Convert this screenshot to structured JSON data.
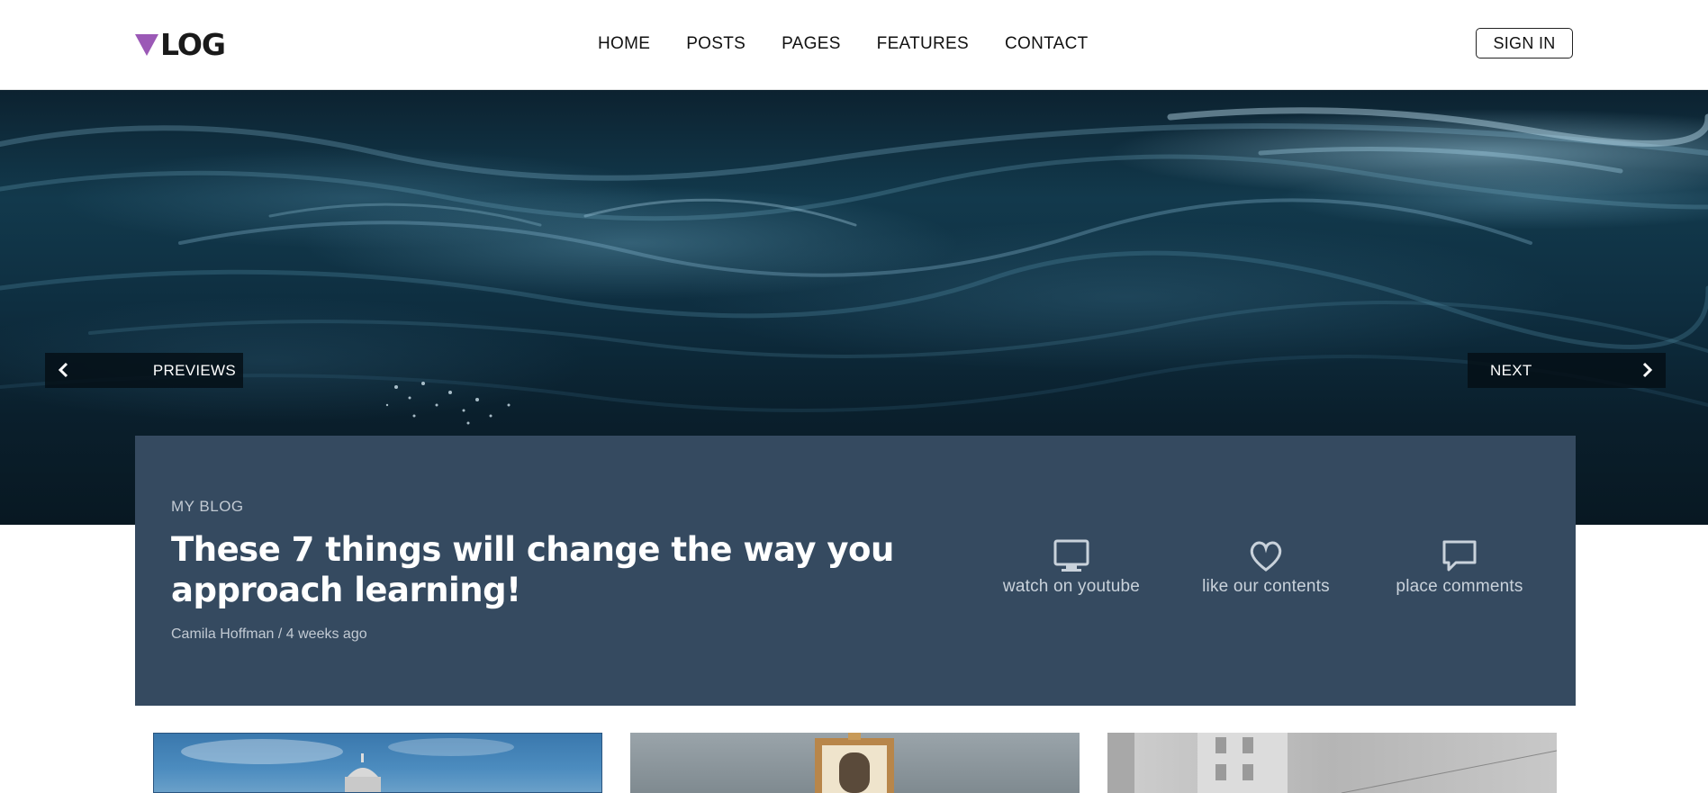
{
  "brand": {
    "logo_text": "LOG",
    "accent_color": "#9b59b6"
  },
  "nav": {
    "items": [
      {
        "label": "HOME"
      },
      {
        "label": "POSTS"
      },
      {
        "label": "PAGES"
      },
      {
        "label": "FEATURES"
      },
      {
        "label": "CONTACT"
      }
    ],
    "signin_label": "SIGN IN"
  },
  "hero": {
    "background": "ocean-waves-photo",
    "prev_label": "PREVIEWS",
    "next_label": "NEXT",
    "prev_icon": "chevron-left-icon",
    "next_icon": "chevron-right-icon"
  },
  "featured": {
    "kicker": "MY BLOG",
    "title": "These 7 things will change the way you approach learning!",
    "author": "Camila Hoffman",
    "separator": "/",
    "time_ago": "4 weeks ago",
    "card_color": "#354a60",
    "actions": [
      {
        "label": "watch on youtube",
        "icon": "monitor-icon"
      },
      {
        "label": "like our contents",
        "icon": "heart-icon"
      },
      {
        "label": "place comments",
        "icon": "comment-icon"
      }
    ]
  },
  "thumbnails": [
    {
      "subject": "blue-sky-domed-building-photo"
    },
    {
      "subject": "ornate-tower-photo"
    },
    {
      "subject": "grey-building-facade-photo"
    }
  ]
}
